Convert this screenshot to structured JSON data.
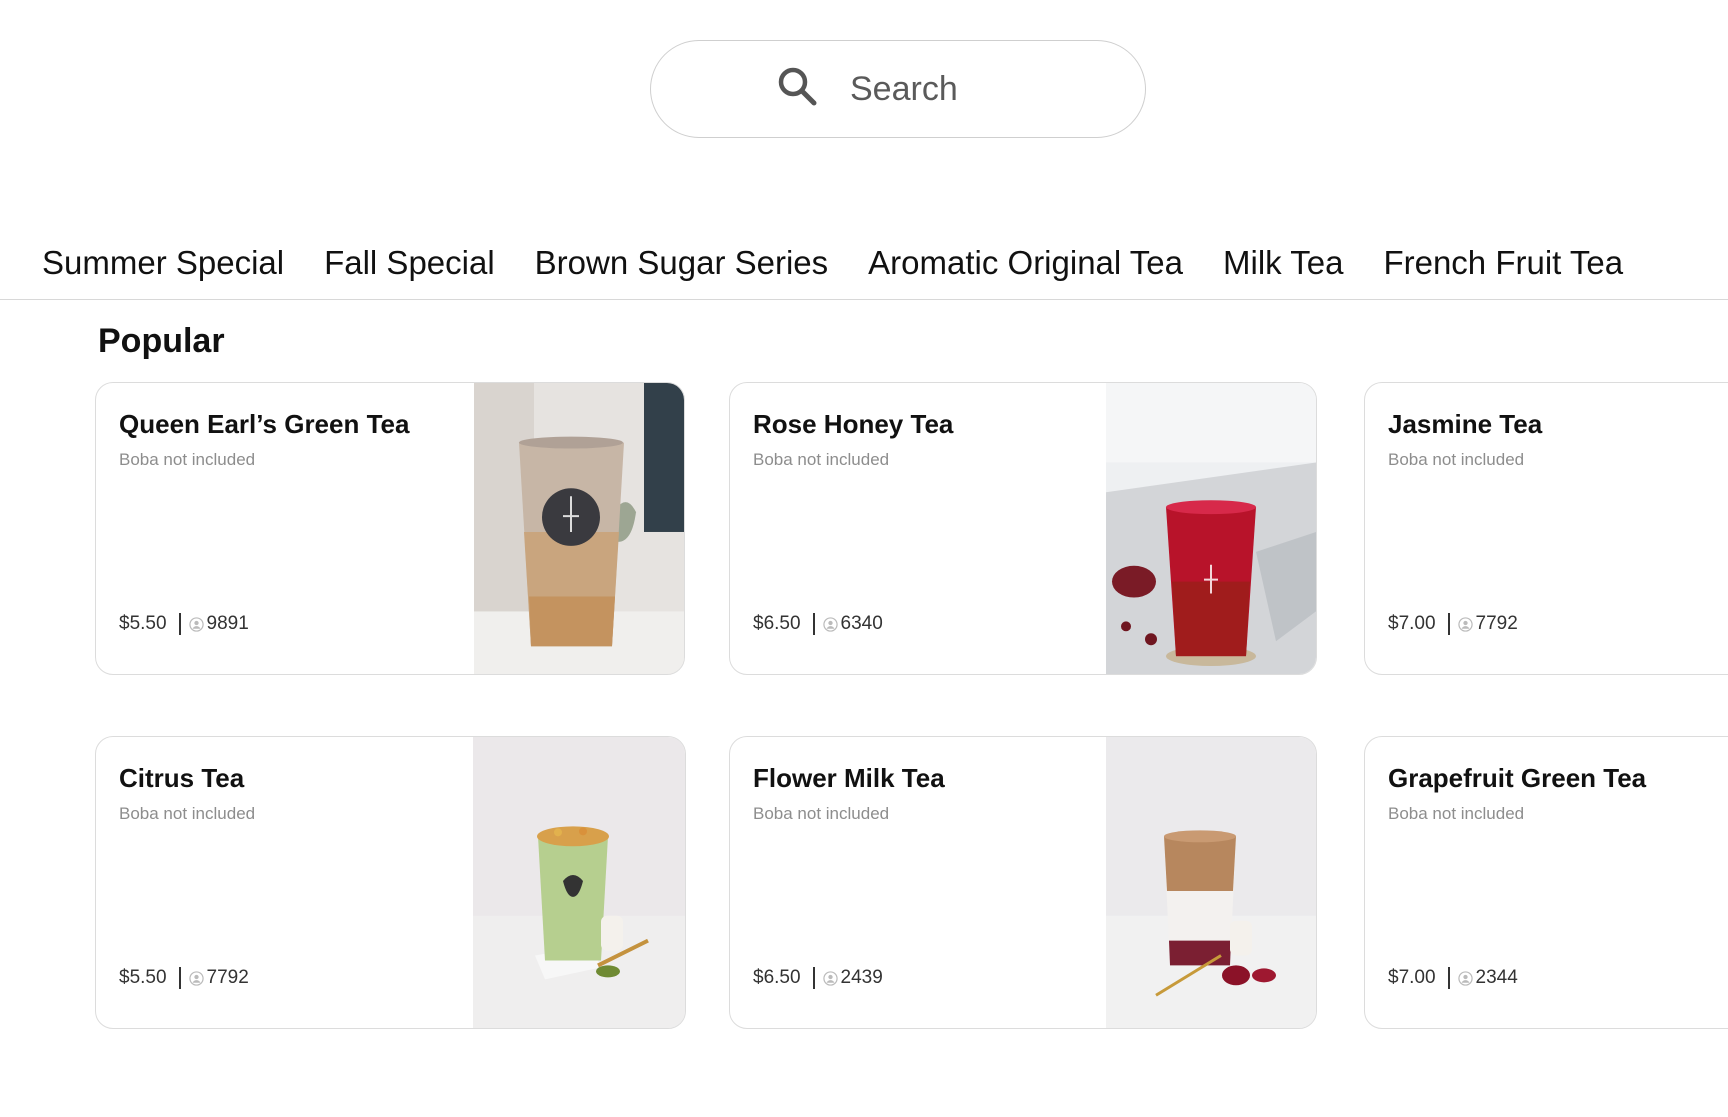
{
  "search": {
    "placeholder": "Search"
  },
  "categories": [
    "Summer Special",
    "Fall Special",
    "Brown Sugar Series",
    "Aromatic Original Tea",
    "Milk Tea",
    "French Fruit Tea"
  ],
  "section_title": "Popular",
  "products": [
    {
      "name": "Queen Earl’s Green Tea",
      "note": "Boba not included",
      "price": "$5.50",
      "count": "9891"
    },
    {
      "name": "Rose Honey Tea",
      "note": "Boba not included",
      "price": "$6.50",
      "count": "6340"
    },
    {
      "name": "Jasmine Tea",
      "note": "Boba not included",
      "price": "$7.00",
      "count": "7792"
    },
    {
      "name": "Citrus Tea",
      "note": "Boba not included",
      "price": "$5.50",
      "count": "7792"
    },
    {
      "name": "Flower Milk Tea",
      "note": "Boba not included",
      "price": "$6.50",
      "count": "2439"
    },
    {
      "name": "Grapefruit Green Tea",
      "note": "Boba not included",
      "price": "$7.00",
      "count": "2344"
    }
  ],
  "icons": {
    "search": "search-icon",
    "count": "person-icon"
  },
  "colors": {
    "border": "#dcdcdc",
    "muted_text": "#8d8d8d"
  }
}
